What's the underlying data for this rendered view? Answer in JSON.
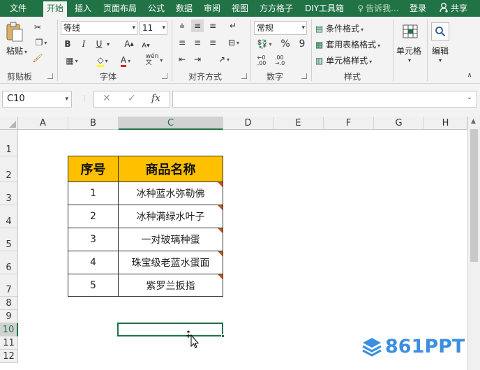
{
  "ribbon_tabs": [
    "文件",
    "开始",
    "插入",
    "页面布局",
    "公式",
    "数据",
    "审阅",
    "视图",
    "方方格子",
    "DIY工具箱"
  ],
  "tell_me": "告诉我...",
  "login": "登录",
  "share": "共享",
  "clipboard": {
    "paste": "粘贴",
    "label": "剪贴板"
  },
  "font": {
    "name": "等线",
    "size": "11",
    "bold": "B",
    "italic": "I",
    "underline": "U",
    "grow": "A",
    "shrink": "A",
    "label": "字体"
  },
  "alignment": {
    "label": "对齐方式"
  },
  "number": {
    "format": "常规",
    "percent": "%",
    "comma": "9",
    "label": "数字"
  },
  "styles": {
    "conditional": "条件格式",
    "table": "套用表格格式",
    "cell": "单元格样式",
    "label": "样式"
  },
  "cells": {
    "label": "单元格"
  },
  "editing": {
    "label": "编辑"
  },
  "formula_bar": {
    "name_box": "C10",
    "cancel": "✕",
    "enter": "✓",
    "fx": "fx",
    "value": ""
  },
  "columns": [
    "A",
    "B",
    "C",
    "D",
    "E",
    "F",
    "G",
    "H"
  ],
  "rows": [
    "1",
    "2",
    "3",
    "4",
    "5",
    "6",
    "7",
    "8",
    "9",
    "10",
    "11",
    "12"
  ],
  "selected_cell": "C10",
  "table": {
    "headers": [
      "序号",
      "商品名称"
    ],
    "rows": [
      [
        "1",
        "冰种蓝水弥勒佛"
      ],
      [
        "2",
        "冰种满绿水叶子"
      ],
      [
        "3",
        "一对玻璃种蛋"
      ],
      [
        "4",
        "珠宝级老蓝水蛋面"
      ],
      [
        "5",
        "紫罗兰扳指"
      ]
    ]
  },
  "watermark": "861PPT",
  "colors": {
    "excel_green": "#217346",
    "header_fill": "#ffc000",
    "comment_marker": "#c0561d",
    "watermark_blue": "#3a8fe0"
  }
}
